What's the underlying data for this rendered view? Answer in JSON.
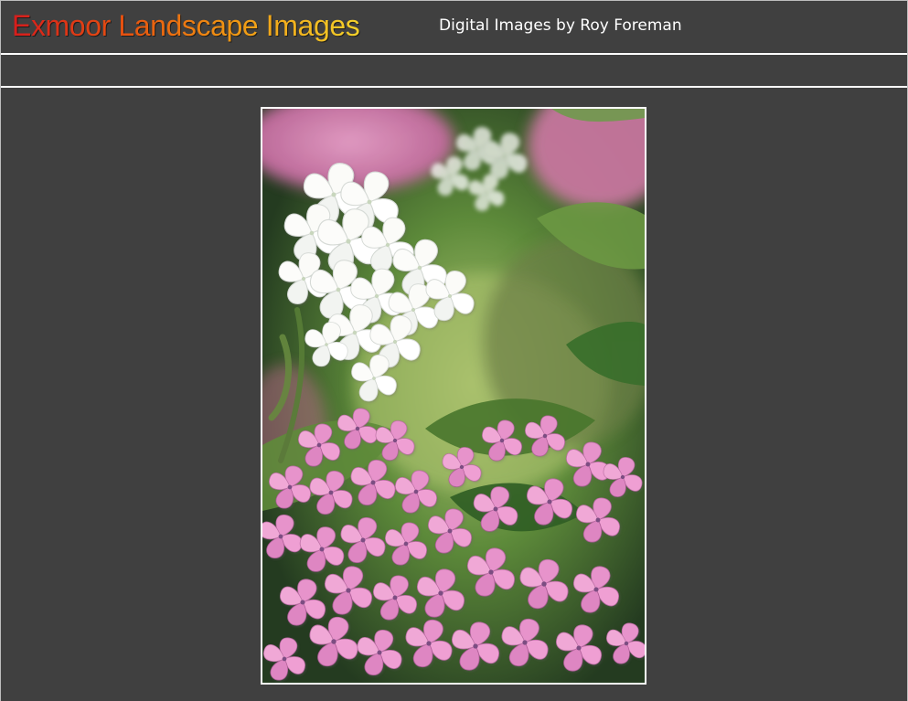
{
  "header": {
    "title": "Exmoor Landscape Images",
    "subtitle": "Digital Images by Roy Foreman"
  },
  "main": {
    "image_name": "hydrangea-photo"
  },
  "colors": {
    "page_background": "#404040",
    "rule": "#ffffff",
    "title_gradient_start": "#d61c1c",
    "title_gradient_end": "#f4d12a",
    "subtitle_text": "#ffffff"
  }
}
